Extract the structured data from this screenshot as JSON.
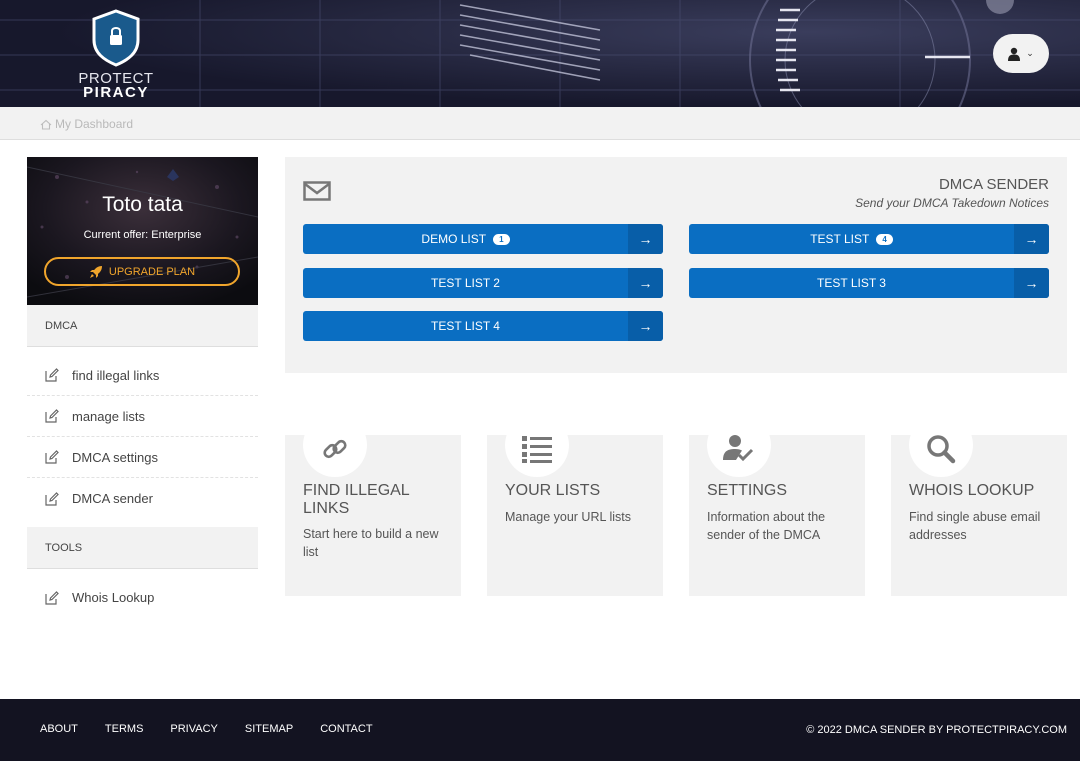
{
  "header": {
    "logo_line1": "PROTECT",
    "logo_line2": "PIRACY",
    "user_menu_icon": "user-icon"
  },
  "breadcrumb": {
    "label": "My Dashboard",
    "icon": "home-icon"
  },
  "profile": {
    "name": "Toto tata",
    "offer": "Current offer: Enterprise",
    "upgrade_label": "UPGRADE PLAN",
    "upgrade_color": "#f0a52c"
  },
  "sidebar": {
    "dmca_heading": "DMCA",
    "dmca_items": [
      {
        "label": "find illegal links"
      },
      {
        "label": "manage lists"
      },
      {
        "label": "DMCA settings"
      },
      {
        "label": "DMCA sender"
      }
    ],
    "tools_heading": "TOOLS",
    "tools_items": [
      {
        "label": "Whois Lookup"
      }
    ]
  },
  "panel": {
    "title": "DMCA SENDER",
    "subtitle": "Send your DMCA Takedown Notices",
    "accent_color": "#0a6ec2",
    "lists": [
      {
        "label": "DEMO LIST",
        "badge": "1"
      },
      {
        "label": "TEST LIST",
        "badge": "4"
      },
      {
        "label": "TEST LIST 2",
        "badge": ""
      },
      {
        "label": "TEST LIST 3",
        "badge": ""
      },
      {
        "label": "TEST LIST 4",
        "badge": ""
      }
    ]
  },
  "cards": [
    {
      "icon": "link-icon",
      "title": "FIND ILLEGAL LINKS",
      "desc": "Start here to build a new list"
    },
    {
      "icon": "list-icon",
      "title": "YOUR LISTS",
      "desc": "Manage your URL lists"
    },
    {
      "icon": "user-check-icon",
      "title": "SETTINGS",
      "desc": "Information about the sender of the DMCA"
    },
    {
      "icon": "search-icon",
      "title": "WHOIS LOOKUP",
      "desc": "Find single abuse email addresses"
    }
  ],
  "footer": {
    "links": [
      "ABOUT",
      "TERMS",
      "PRIVACY",
      "SITEMAP",
      "CONTACT"
    ],
    "copyright": "© 2022 DMCA SENDER BY PROTECTPIRACY.COM"
  }
}
